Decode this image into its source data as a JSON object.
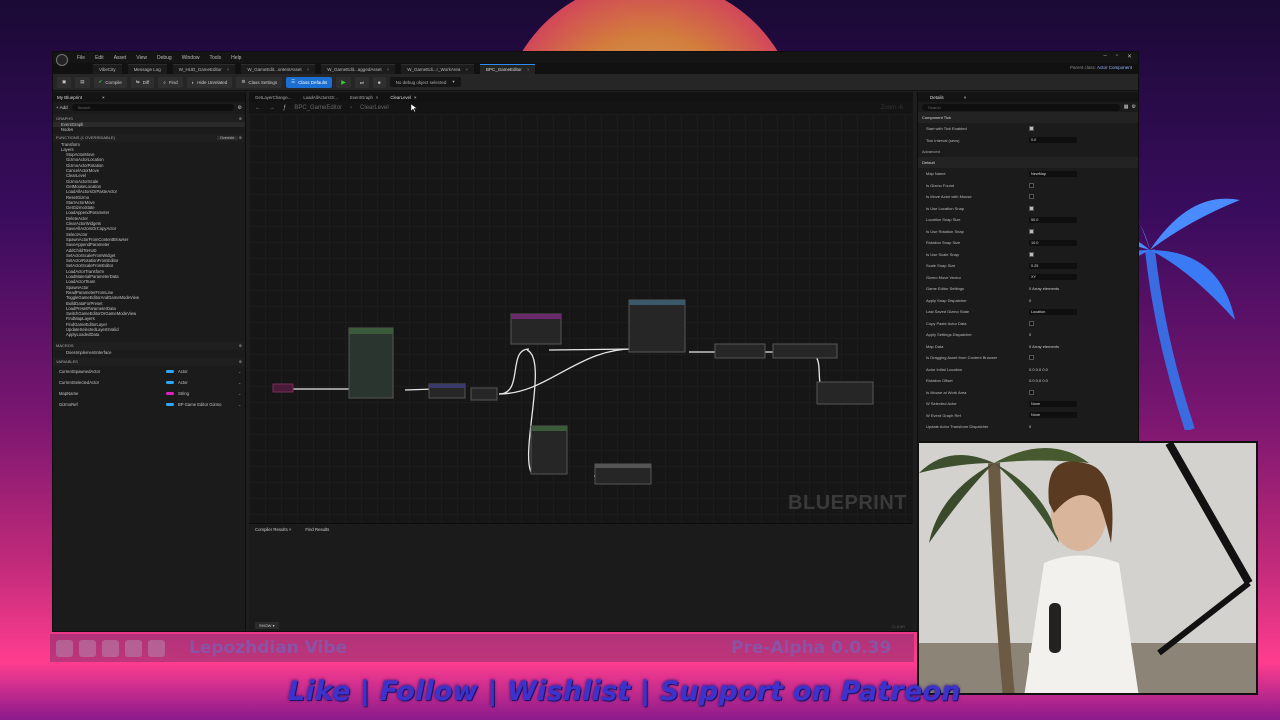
{
  "window": {
    "menus": [
      "File",
      "Edit",
      "Asset",
      "View",
      "Debug",
      "Window",
      "Tools",
      "Help"
    ],
    "project_tab": "VibeCity",
    "message_log": "Message Log",
    "doc_tabs": [
      "W_HUD_GameEditor",
      "W_GameEdit...ontentAsset",
      "W_GameEdit...aggedAsset",
      "W_GameEdi...r_WorkArea",
      "BPC_GameEditor"
    ],
    "parent_class_label": "Parent class:",
    "parent_class_value": "Actor Component"
  },
  "toolbar": {
    "compile": "Compile",
    "diff": "Diff",
    "find": "Find",
    "hide_unrelated": "Hide Unrelated",
    "class_settings": "Class Settings",
    "class_defaults": "Class Defaults",
    "debug_object": "No debug object selected"
  },
  "my_blueprint": {
    "tab": "My Blueprint",
    "add": "+ Add",
    "search_placeholder": "Search",
    "graphs_header": "GRAPHS",
    "graphs": [
      "EventGraph",
      "Nodes"
    ],
    "functions_header": "FUNCTIONS (1 OVERRIDABLE)",
    "override": "Override",
    "functions": [
      "Transform",
      "Layers",
      "StopActorMove",
      "GizmoActorLocation",
      "GizmoActorRotation",
      "CancelActorMove",
      "ClearLevel",
      "GizmoActorScale",
      "GetMouseLocation",
      "LoadAllActorsOrPasteActor",
      "ResetGizmo",
      "StartActorMove",
      "GetGizmoState",
      "LoadAppendParameter",
      "DeleteActor",
      "ClearActorWidgets",
      "SaveAllActorsOrCopyActor",
      "SelectActor",
      "SpawnActorFromContentBrowser",
      "SaveAppendParameter",
      "AddChildToHUD",
      "SetActorScaleFromWidget",
      "SetActorRotationFromEditor",
      "SetActorScaleFromEditor",
      "LoadActorTransform",
      "LoadMaterialParameterData",
      "LoadActorTeam",
      "SpawnActor",
      "ReadParameterFromLine",
      "ToggleGameEditorAndGameModeView",
      "BuildDataForPreset",
      "LoadPresetParameterData",
      "SwitchGameEditorOrGameModeView",
      "FindMapLayers",
      "FindGameEditorLayer",
      "UpdateSelectedLayerIsValid",
      "ApplyLoadedData"
    ],
    "macros_header": "MACROS",
    "macros": [
      "DoesImplementInterface"
    ],
    "variables_header": "VARIABLES",
    "variables": [
      {
        "name": "CurrentSpawnedActor",
        "type": "Actor",
        "color": "#2fa6ff"
      },
      {
        "name": "CurrentSelectedActor",
        "type": "Actor",
        "color": "#2fa6ff"
      },
      {
        "name": "MapName",
        "type": "String",
        "color": "#e020c0"
      },
      {
        "name": "GizmoRef",
        "type": "BP Game Editor Gizmo",
        "color": "#2fa6ff"
      }
    ]
  },
  "graph": {
    "tabs": [
      "GetLayerChange...",
      "LoadAllActorsOr...",
      "EventGraph",
      "ClearLevel"
    ],
    "breadcrumb_root": "BPC_GameEditor",
    "breadcrumb_leaf": "ClearLevel",
    "zoom": "Zoom -6",
    "watermark": "BLUEPRINT",
    "results_tabs": [
      "Compiler Results",
      "Find Results"
    ],
    "show_btn": "SHOW",
    "clear_btn": "CLEAR"
  },
  "details": {
    "tab": "Details",
    "search_placeholder": "Search",
    "sections": {
      "component_tick": "Component Tick",
      "advanced": "Advanced",
      "default": "Default"
    },
    "rows_tick": [
      {
        "label": "Start with Tick Enabled",
        "kind": "checkbox",
        "on": true
      },
      {
        "label": "Tick Interval (secs)",
        "kind": "input",
        "value": "0.0"
      }
    ],
    "rows_default": [
      {
        "label": "Map Name",
        "kind": "input",
        "value": "NewMap"
      },
      {
        "label": "Is Gizmo Found",
        "kind": "checkbox",
        "on": false
      },
      {
        "label": "Is Move Actor with Mouse",
        "kind": "checkbox",
        "on": false
      },
      {
        "label": "Is Use Location Snap",
        "kind": "checkbox",
        "on": true
      },
      {
        "label": "Location Snap Size",
        "kind": "input",
        "value": "50.0"
      },
      {
        "label": "Is Use Rotation Snap",
        "kind": "checkbox",
        "on": true
      },
      {
        "label": "Rotation Snap Size",
        "kind": "input",
        "value": "10.0"
      },
      {
        "label": "Is Use Scale Snap",
        "kind": "checkbox",
        "on": true
      },
      {
        "label": "Scale Snap Size",
        "kind": "input",
        "value": "0.25"
      },
      {
        "label": "Gizmo Move Vector",
        "kind": "input",
        "value": "XY"
      },
      {
        "label": "Game Editor Settings",
        "kind": "text",
        "value": "0 Array elements"
      },
      {
        "label": "Apply Snap Dispatcher",
        "kind": "text",
        "value": "0"
      },
      {
        "label": "Last Saved Gizmo State",
        "kind": "input",
        "value": "Location"
      },
      {
        "label": "Copy Paste Actor Data",
        "kind": "checkbox",
        "on": false
      },
      {
        "label": "Apply Settings Dispatcher",
        "kind": "text",
        "value": "0"
      },
      {
        "label": "Map Data",
        "kind": "text",
        "value": "0 Array elements"
      },
      {
        "label": "Is Dragging Asset from Content Browser",
        "kind": "checkbox",
        "on": false
      },
      {
        "label": "Actor Initial Location",
        "kind": "text",
        "value": "0.0   0.0   0.0"
      },
      {
        "label": "Rotation Offset",
        "kind": "text",
        "value": "0.0   0.0   0.0"
      },
      {
        "label": "Is Mouse at Work Area",
        "kind": "checkbox",
        "on": false
      },
      {
        "label": "W Selected Actor",
        "kind": "input",
        "value": "None"
      },
      {
        "label": "W Event Graph Ref",
        "kind": "input",
        "value": "None"
      },
      {
        "label": "Update Actor Transform Dispatcher",
        "kind": "text",
        "value": "0"
      }
    ]
  },
  "overlay": {
    "channel": "Lepozhdian Vibe",
    "version": "Pre-Alpha 0.0.39",
    "cta": "Like | Follow | Wishlist | Support on Patreon",
    "socials": [
      "youtube-icon",
      "twitch-icon",
      "steam-icon",
      "patreon-icon",
      "discord-icon"
    ]
  }
}
